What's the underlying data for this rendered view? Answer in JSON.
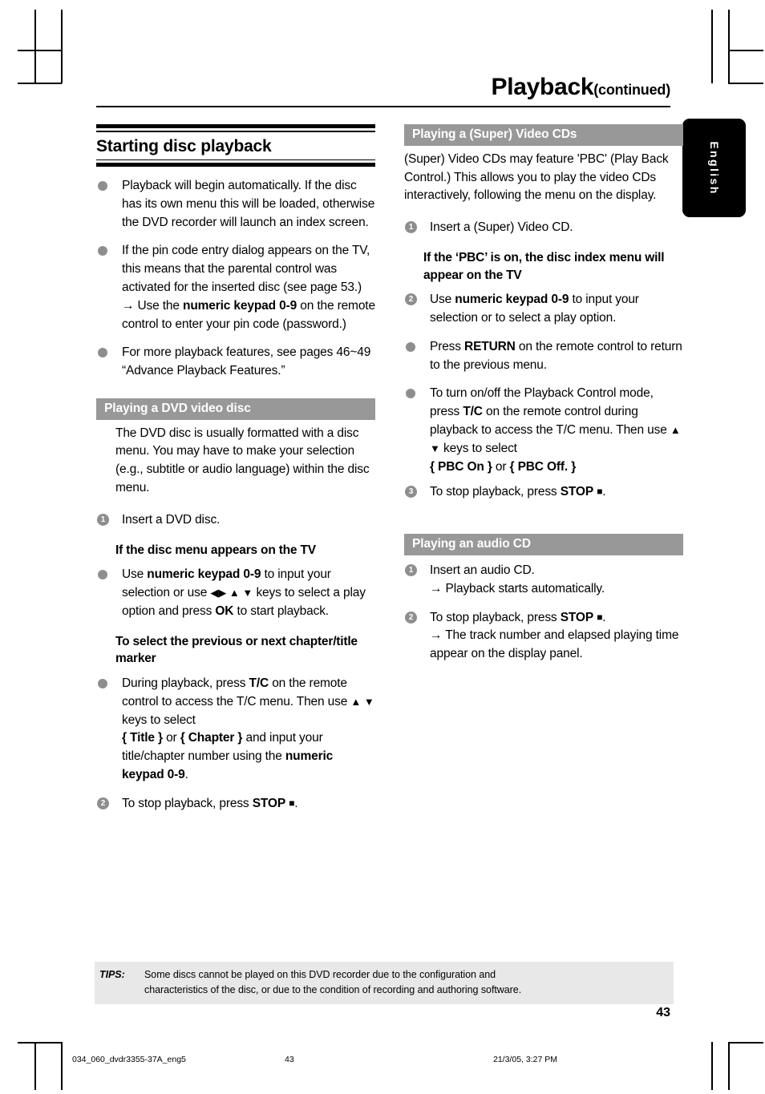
{
  "header": {
    "title_main": "Playback",
    "title_sub": "(continued)"
  },
  "language_tab": {
    "label": "English"
  },
  "left_column": {
    "section_heading": "Starting disc playback",
    "bullets": [
      {
        "marker": "dot",
        "text": "Playback will begin automatically.  If the disc has its own menu this will be loaded, otherwise the DVD recorder will launch an index screen."
      },
      {
        "marker": "dot",
        "text_a": "If the pin code entry dialog appears on the TV, this means that the parental control was activated for the inserted disc (see page 53.)",
        "arrow_lead": "→ Use the ",
        "arrow_bold": "numeric keypad 0-9",
        "arrow_tail": " on the remote control to enter your pin code (password.)"
      },
      {
        "marker": "dot",
        "text": "For more playback features, see pages 46~49 “Advance Playback Features.”"
      }
    ],
    "dvd_section": {
      "bar_label": "Playing a DVD video disc",
      "intro": "The DVD disc is usually formatted with a disc menu. You may have to make your selection (e.g., subtitle or audio language) within the disc menu.",
      "step1_num": "1",
      "step1_text": "Insert a DVD disc.",
      "subhead1": "If the disc menu appears on the TV",
      "bullet1_lead": "Use ",
      "bullet1_bold": "numeric keypad 0-9",
      "bullet1_mid": " to input your selection or use ",
      "bullet1_keys": "◀▶ ▲ ▼",
      "bullet1_mid2": " keys to select a play option and press ",
      "bullet1_bold2": "OK",
      "bullet1_tail": " to start playback.",
      "subhead2": "To select the previous or next chapter/title marker",
      "bullet2_lead": "During playback, press ",
      "bullet2_bold": "T/C",
      "bullet2_mid": " on the remote control to access the T/C menu. Then use ",
      "bullet2_keys": "▲ ▼",
      "bullet2_mid2": " keys to select",
      "bullet2_brace1": "{ Title }",
      "bullet2_or": " or ",
      "bullet2_brace2": "{ Chapter }",
      "bullet2_mid3": " and input your title/chapter number using the ",
      "bullet2_bold2": "numeric keypad 0-9",
      "bullet2_tail": ".",
      "step2_num": "2",
      "step2_lead": "To stop playback, press ",
      "step2_bold": "STOP",
      "step2_tail": "."
    }
  },
  "right_column": {
    "vcd_section": {
      "bar_label": "Playing a (Super) Video CDs",
      "intro": "(Super) Video CDs may feature 'PBC' (Play Back Control.)  This allows you to play the video CDs interactively, following the menu on the display.",
      "step1_num": "1",
      "step1_text": "Insert a (Super) Video CD.",
      "subhead1": "If the ‘PBC’ is on, the disc index menu will appear on the TV",
      "step2_num": "2",
      "step2_lead": "Use ",
      "step2_bold": "numeric keypad 0-9",
      "step2_tail": " to input your selection or to select a play option.",
      "bullet1_lead": "Press ",
      "bullet1_bold": "RETURN",
      "bullet1_tail": " on the remote control to return to the previous menu.",
      "bullet2_lead": "To turn on/off the Playback Control mode, press ",
      "bullet2_bold": "T/C",
      "bullet2_mid": " on the remote control during playback to access the T/C menu. Then use ",
      "bullet2_keys": "▲ ▼",
      "bullet2_mid2": " keys to select",
      "bullet2_brace1": "{ PBC On }",
      "bullet2_or": " or ",
      "bullet2_brace2": "{ PBC Off. }",
      "step3_num": "3",
      "step3_lead": "To stop playback, press ",
      "step3_bold": "STOP",
      "step3_tail": "."
    },
    "cd_section": {
      "bar_label": "Playing an audio CD",
      "step1_num": "1",
      "step1_text": "Insert an audio CD.",
      "step1_arrow": "→ Playback starts automatically.",
      "step2_num": "2",
      "step2_lead": "To stop playback, press ",
      "step2_bold": "STOP",
      "step2_tail": ".",
      "step2_arrow": "→ The track number and elapsed playing time appear on the display panel."
    }
  },
  "tips": {
    "label": "TIPS:",
    "line1": "Some discs cannot be played on this DVD recorder due to the configuration and",
    "line2": "characteristics of the disc, or due to the condition of recording and authoring software."
  },
  "folio": "43",
  "print_footer": {
    "file": "034_060_dvdr3355-37A_eng5",
    "page": "43",
    "date": "21/3/05, 3:27 PM"
  }
}
